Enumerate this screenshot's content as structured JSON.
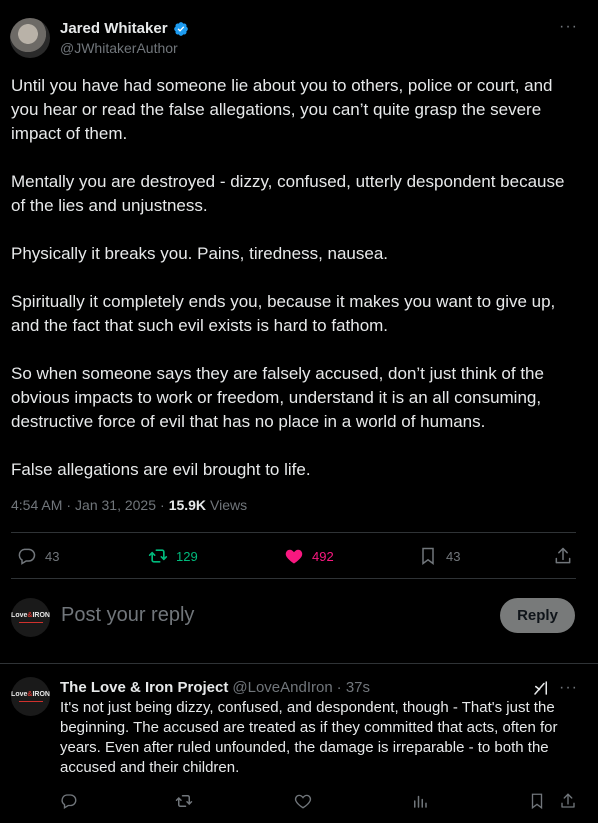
{
  "tweet": {
    "author_name": "Jared Whitaker",
    "author_handle": "@JWhitakerAuthor",
    "more_label": "···",
    "paragraphs": [
      "Until you have had someone lie about you to others, police or court, and you hear or read the false allegations, you can’t quite grasp the severe impact of them.",
      "Mentally you are destroyed - dizzy, confused, utterly despondent because of the lies and unjustness.",
      "Physically it breaks you. Pains, tiredness, nausea.",
      "Spiritually it completely ends you, because it makes you want to give up, and the fact that such evil exists is hard to fathom.",
      "So when someone says they are falsely accused, don’t just think of the obvious impacts to work or freedom, understand it is an all consuming, destructive force of evil that has no place in a world of humans.",
      "False allegations are evil brought to life."
    ],
    "time": "4:54 AM",
    "date": "Jan 31, 2025",
    "views_count": "15.9K",
    "views_label": "Views",
    "replies": "43",
    "reposts": "129",
    "likes": "492",
    "bookmarks": "43",
    "repost_color": "#00ba7c",
    "like_color": "#f91880",
    "verified_color": "#1d9bf0"
  },
  "composer": {
    "placeholder": "Post your reply",
    "reply_label": "Reply",
    "avatar_logo_line1": "Love",
    "avatar_logo_amp": "&",
    "avatar_logo_line2": "IRON"
  },
  "reply": {
    "author_name": "The Love & Iron Project",
    "author_handle": "@LoveAndIron",
    "time": "· 37s",
    "more_label": "···",
    "text": "It's not just being dizzy, confused, and despondent, though - That's just the beginning. The accused are treated as if they committed that acts, often for years. Even after ruled unfounded, the damage is irreparable - to both the accused and their children."
  }
}
